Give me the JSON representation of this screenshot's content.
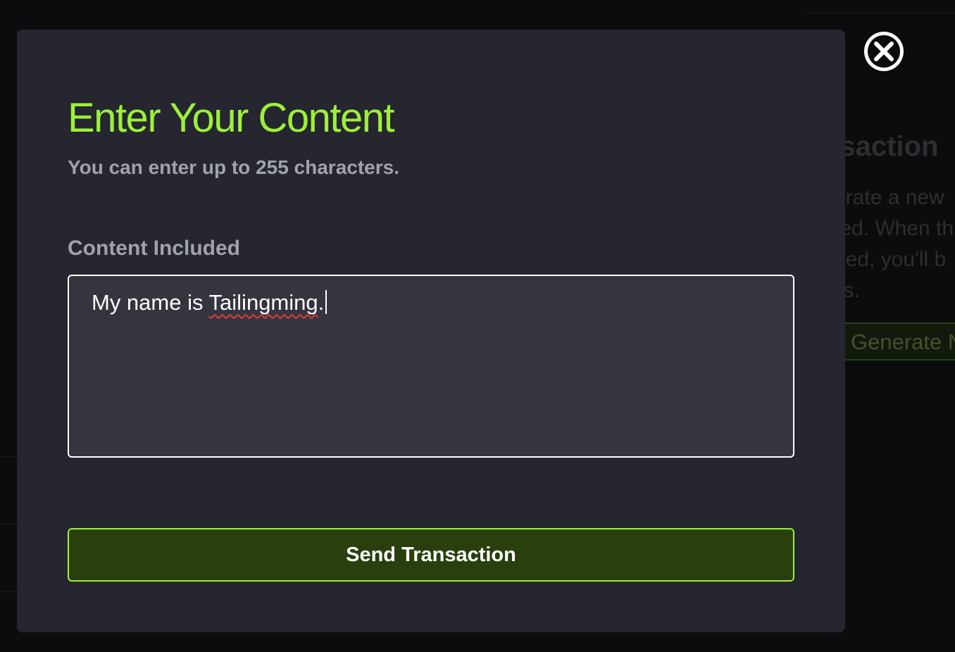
{
  "background": {
    "heading_fragment": "nsaction",
    "text_fragments": [
      "erate a new",
      "ted. When th",
      "hed, you'll b",
      "ils."
    ],
    "button_fragment": "Generate N"
  },
  "close_icon": "close-circle-icon",
  "modal": {
    "title": "Enter Your Content",
    "subtitle": "You can enter up to 255 characters.",
    "field_label": "Content Included",
    "content": {
      "prefix": "My name is ",
      "flagged_word": "Tailingming",
      "suffix": "."
    },
    "send_label": "Send Transaction"
  },
  "colors": {
    "accent": "#9df03a",
    "button_bg": "#293f0e",
    "modal_bg": "#25262f",
    "input_bg": "#34353f",
    "page_bg": "#0b0c0e"
  }
}
